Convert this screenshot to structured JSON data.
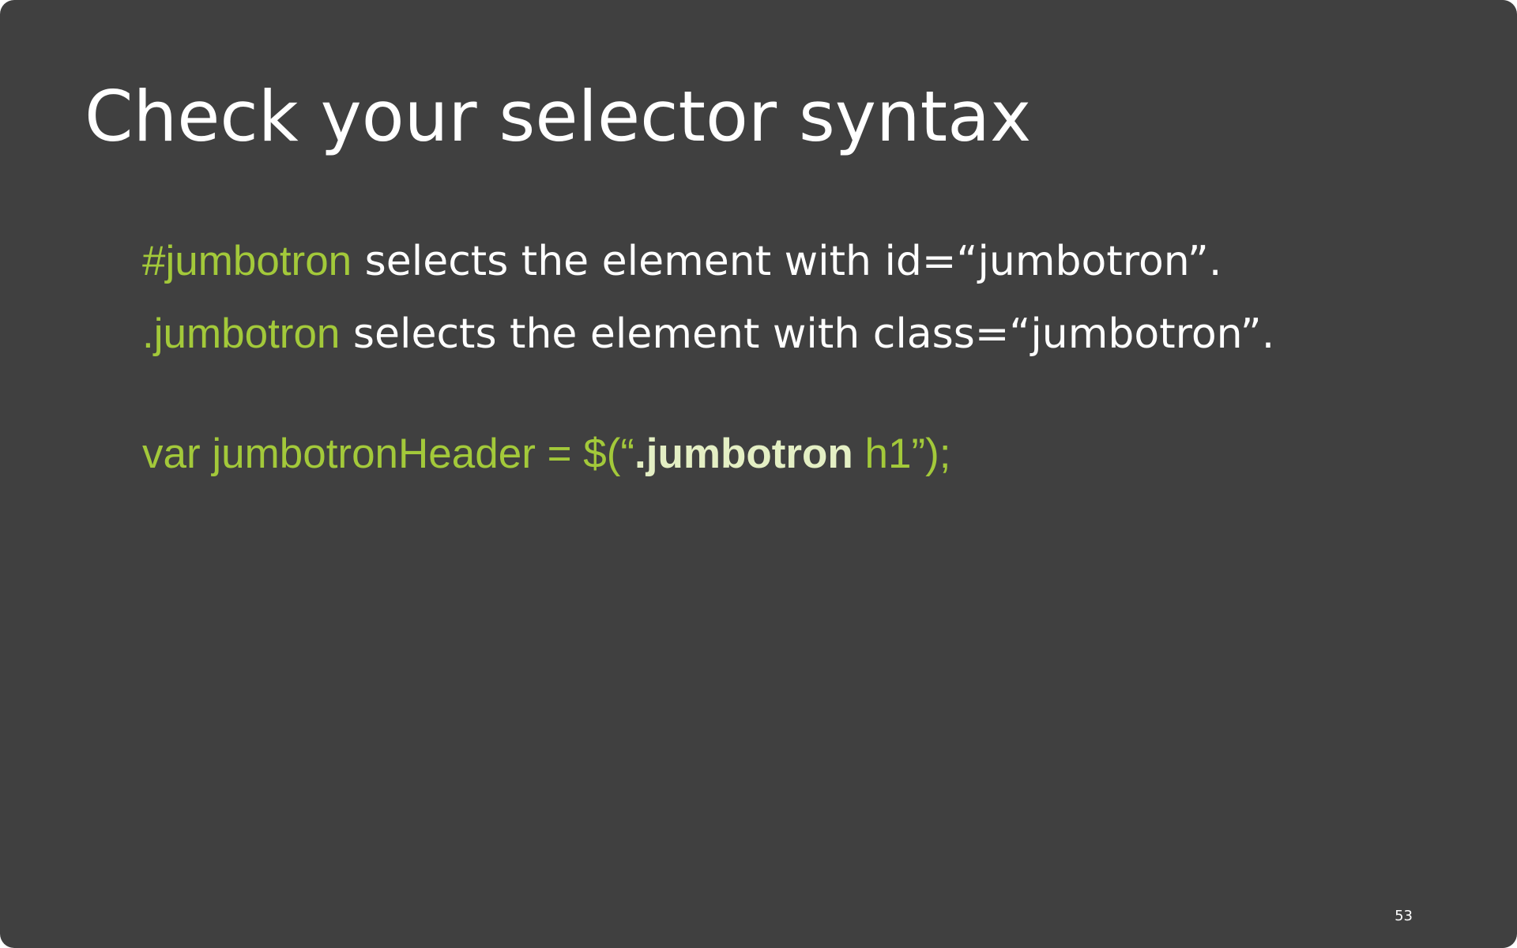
{
  "slide": {
    "title": "Check your selector syntax",
    "line1": {
      "selector": "#jumbotron",
      "text": " selects the element with id=“jumbotron”."
    },
    "line2": {
      "selector": ".jumbotron",
      "text": " selects the element with class=“jumbotron”."
    },
    "code_example": {
      "prefix": "var jumbotronHeader = $(“",
      "highlight": ".jumbotron",
      "suffix": " h1”);"
    },
    "page_number": "53"
  },
  "colors": {
    "background": "#404040",
    "code_green": "#a3c93a",
    "highlight": "#e4efc4",
    "text": "#ffffff"
  }
}
